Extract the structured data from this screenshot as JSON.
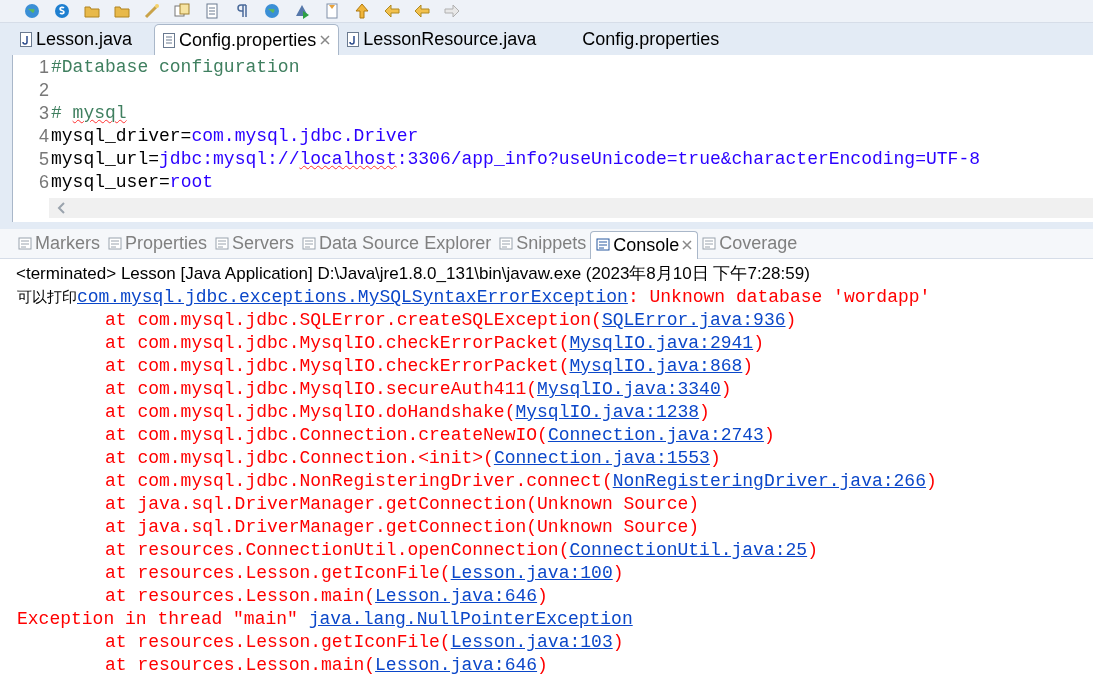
{
  "toolbar": {
    "icons": [
      {
        "kind": "globe"
      },
      {
        "kind": "skype"
      },
      {
        "kind": "folder"
      },
      {
        "kind": "folder"
      },
      {
        "kind": "wand"
      },
      {
        "kind": "copy"
      },
      {
        "kind": "document"
      },
      {
        "kind": "pilcrow"
      },
      {
        "kind": "globe"
      },
      {
        "kind": "run"
      },
      {
        "kind": "bookmark"
      },
      {
        "kind": "up"
      },
      {
        "kind": "back"
      },
      {
        "kind": "back"
      },
      {
        "kind": "forward"
      }
    ]
  },
  "editor_tabs": [
    {
      "label": "Lesson.java",
      "kind": "java",
      "selected": false
    },
    {
      "label": "Config.properties",
      "kind": "props",
      "selected": true
    },
    {
      "label": "LessonResource.java",
      "kind": "java",
      "selected": false
    },
    {
      "label": "Config.properties",
      "kind": "none",
      "selected": false
    }
  ],
  "editor": {
    "lines": [
      {
        "number": "1",
        "segments": [
          {
            "kind": "comment",
            "text": "#Database configuration"
          }
        ]
      },
      {
        "number": "2"
      },
      {
        "number": "3",
        "segments": [
          {
            "kind": "comment",
            "text": "# "
          },
          {
            "kind": "comment",
            "text": "mysql",
            "misspelled": true
          }
        ]
      },
      {
        "number": "4",
        "segments": [
          {
            "kind": "key",
            "text": "mysql_driver="
          },
          {
            "kind": "value",
            "text": "com.mysql.jdbc.Driver"
          }
        ]
      },
      {
        "number": "5",
        "segments": [
          {
            "kind": "key",
            "text": "mysql_url="
          },
          {
            "kind": "value",
            "text": "jdbc:mysql://"
          },
          {
            "kind": "value",
            "text": "localhost",
            "misspelled": true
          },
          {
            "kind": "value",
            "text": ":3306/app_info?useUnicode=true&characterEncoding=UTF-8"
          }
        ]
      },
      {
        "number": "6",
        "segments": [
          {
            "kind": "key",
            "text": "mysql_user="
          },
          {
            "kind": "value",
            "text": "root"
          }
        ]
      }
    ]
  },
  "view_tabs": [
    {
      "label": "Markers",
      "selected": false
    },
    {
      "label": "Properties",
      "selected": false
    },
    {
      "label": "Servers",
      "selected": false
    },
    {
      "label": "Data Source Explorer",
      "selected": false
    },
    {
      "label": "Snippets",
      "selected": false
    },
    {
      "label": "Console",
      "selected": true
    },
    {
      "label": "Coverage",
      "selected": false
    }
  ],
  "console": {
    "header": "<terminated> Lesson [Java Application] D:\\Java\\jre1.8.0_131\\bin\\javaw.exe (2023年8月10日 下午7:28:59)",
    "lines": [
      {
        "indent": false,
        "segments": [
          {
            "kind": "out",
            "text": "可以打印"
          },
          {
            "kind": "link",
            "text": "com.mysql.jdbc.exceptions.MySQLSyntaxErrorException"
          },
          {
            "kind": "err",
            "text": ": Unknown database 'wordapp'"
          }
        ]
      },
      {
        "indent": true,
        "segments": [
          {
            "kind": "err",
            "text": "at com.mysql.jdbc.SQLError.createSQLException("
          },
          {
            "kind": "link",
            "text": "SQLError.java:936"
          },
          {
            "kind": "err",
            "text": ")"
          }
        ]
      },
      {
        "indent": true,
        "segments": [
          {
            "kind": "err",
            "text": "at com.mysql.jdbc.MysqlIO.checkErrorPacket("
          },
          {
            "kind": "link",
            "text": "MysqlIO.java:2941"
          },
          {
            "kind": "err",
            "text": ")"
          }
        ]
      },
      {
        "indent": true,
        "segments": [
          {
            "kind": "err",
            "text": "at com.mysql.jdbc.MysqlIO.checkErrorPacket("
          },
          {
            "kind": "link",
            "text": "MysqlIO.java:868"
          },
          {
            "kind": "err",
            "text": ")"
          }
        ]
      },
      {
        "indent": true,
        "segments": [
          {
            "kind": "err",
            "text": "at com.mysql.jdbc.MysqlIO.secureAuth411("
          },
          {
            "kind": "link",
            "text": "MysqlIO.java:3340"
          },
          {
            "kind": "err",
            "text": ")"
          }
        ]
      },
      {
        "indent": true,
        "segments": [
          {
            "kind": "err",
            "text": "at com.mysql.jdbc.MysqlIO.doHandshake("
          },
          {
            "kind": "link",
            "text": "MysqlIO.java:1238"
          },
          {
            "kind": "err",
            "text": ")"
          }
        ]
      },
      {
        "indent": true,
        "segments": [
          {
            "kind": "err",
            "text": "at com.mysql.jdbc.Connection.createNewIO("
          },
          {
            "kind": "link",
            "text": "Connection.java:2743"
          },
          {
            "kind": "err",
            "text": ")"
          }
        ]
      },
      {
        "indent": true,
        "segments": [
          {
            "kind": "err",
            "text": "at com.mysql.jdbc.Connection.<init>("
          },
          {
            "kind": "link",
            "text": "Connection.java:1553"
          },
          {
            "kind": "err",
            "text": ")"
          }
        ]
      },
      {
        "indent": true,
        "segments": [
          {
            "kind": "err",
            "text": "at com.mysql.jdbc.NonRegisteringDriver.connect("
          },
          {
            "kind": "link",
            "text": "NonRegisteringDriver.java:266"
          },
          {
            "kind": "err",
            "text": ")"
          }
        ]
      },
      {
        "indent": true,
        "segments": [
          {
            "kind": "err",
            "text": "at java.sql.DriverManager.getConnection(Unknown Source)"
          }
        ]
      },
      {
        "indent": true,
        "segments": [
          {
            "kind": "err",
            "text": "at java.sql.DriverManager.getConnection(Unknown Source)"
          }
        ]
      },
      {
        "indent": true,
        "segments": [
          {
            "kind": "err",
            "text": "at resources.ConnectionUtil.openConnection("
          },
          {
            "kind": "link",
            "text": "ConnectionUtil.java:25"
          },
          {
            "kind": "err",
            "text": ")"
          }
        ]
      },
      {
        "indent": true,
        "segments": [
          {
            "kind": "err",
            "text": "at resources.Lesson.getIconFile("
          },
          {
            "kind": "link",
            "text": "Lesson.java:100"
          },
          {
            "kind": "err",
            "text": ")"
          }
        ]
      },
      {
        "indent": true,
        "segments": [
          {
            "kind": "err",
            "text": "at resources.Lesson.main("
          },
          {
            "kind": "link",
            "text": "Lesson.java:646"
          },
          {
            "kind": "err",
            "text": ")"
          }
        ]
      },
      {
        "indent": false,
        "segments": [
          {
            "kind": "err",
            "text": "Exception in thread \"main\" "
          },
          {
            "kind": "link",
            "text": "java.lang.NullPointerException"
          }
        ]
      },
      {
        "indent": true,
        "segments": [
          {
            "kind": "err",
            "text": "at resources.Lesson.getIconFile("
          },
          {
            "kind": "link",
            "text": "Lesson.java:103"
          },
          {
            "kind": "err",
            "text": ")"
          }
        ]
      },
      {
        "indent": true,
        "segments": [
          {
            "kind": "err",
            "text": "at resources.Lesson.main("
          },
          {
            "kind": "link",
            "text": "Lesson.java:646"
          },
          {
            "kind": "err",
            "text": ")"
          }
        ]
      }
    ]
  }
}
